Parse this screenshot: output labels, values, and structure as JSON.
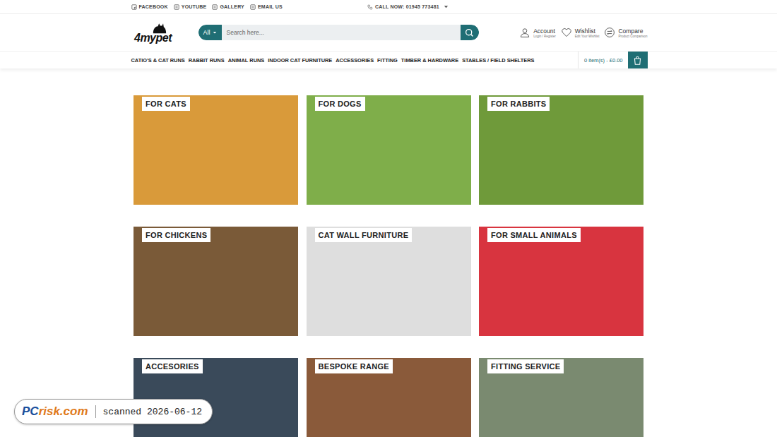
{
  "topbar": {
    "links": [
      "FACEBOOK",
      "YOUTUBE",
      "GALLERY",
      "EMAIL US"
    ],
    "phone": "CALL NOW: 01945 773481"
  },
  "logo": {
    "text": "4mypet"
  },
  "search": {
    "category": "All",
    "placeholder": "Search here..."
  },
  "account": [
    {
      "title": "Account",
      "subtitle": "Login / Register"
    },
    {
      "title": "Wishlist",
      "subtitle": "Edit Your Wishlist"
    },
    {
      "title": "Compare",
      "subtitle": "Product Comparison"
    }
  ],
  "nav": [
    "CATIO'S & CAT RUNS",
    "RABBIT RUNS",
    "ANIMAL RUNS",
    "INDOOR CAT FURNITURE",
    "ACCESSORIES",
    "FITTING",
    "TIMBER & HARDWARE",
    "STABLES / FIELD SHELTERS"
  ],
  "cart": {
    "summary": "0 item(s) - £0.00"
  },
  "tiles": [
    {
      "label": "FOR CATS",
      "color": "#d99a3a"
    },
    {
      "label": "FOR DOGS",
      "color": "#7fae4a"
    },
    {
      "label": "FOR RABBITS",
      "color": "#6f9a3a"
    },
    {
      "label": "FOR CHICKENS",
      "color": "#7a5a38"
    },
    {
      "label": "CAT WALL FURNITURE",
      "color": "#dedede"
    },
    {
      "label": "FOR SMALL ANIMALS",
      "color": "#d8343f"
    },
    {
      "label": "ACCESORIES",
      "color": "#3a4a5a"
    },
    {
      "label": "BESPOKE RANGE",
      "color": "#8a5a3a"
    },
    {
      "label": "FITTING SERVICE",
      "color": "#7a8a70"
    }
  ],
  "watermark": {
    "brand_first": "PC",
    "brand_rest": "risk.com",
    "text": "scanned 2026-06-12"
  }
}
